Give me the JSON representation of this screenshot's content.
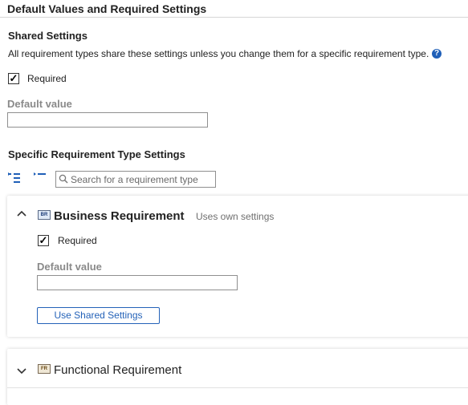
{
  "section": {
    "title": "Default Values and Required Settings"
  },
  "shared": {
    "heading": "Shared Settings",
    "description": "All requirement types share these settings unless you change them for a specific requirement type.",
    "help_icon": "question-circle-icon",
    "required_label": "Required",
    "required_checked": true,
    "default_value_label": "Default value",
    "default_value": ""
  },
  "specific": {
    "heading": "Specific Requirement Type Settings",
    "search_placeholder": "Search for a requirement type",
    "expand_all_icon": "expand-all-icon",
    "collapse_all_icon": "collapse-all-icon"
  },
  "types": [
    {
      "badge": "BR",
      "name": "Business Requirement",
      "note": "Uses own settings",
      "expanded": true,
      "required_label": "Required",
      "required_checked": true,
      "default_value_label": "Default value",
      "default_value": "",
      "button_label": "Use Shared Settings"
    },
    {
      "badge": "FR",
      "name": "Functional Requirement",
      "expanded": false
    }
  ],
  "colors": {
    "accent": "#2462b8",
    "help": "#1f5fb8",
    "muted_label": "#8a8a8a"
  }
}
